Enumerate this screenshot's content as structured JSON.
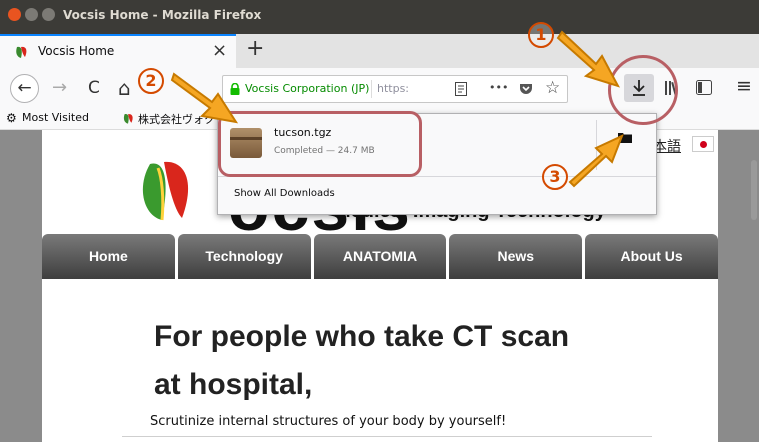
{
  "window": {
    "title": "Vocsis Home - Mozilla Firefox"
  },
  "tabs": [
    {
      "label": "Vocsis Home",
      "close": "×"
    }
  ],
  "toolbar": {
    "new_tab": "+",
    "back": "←",
    "forward": "→",
    "reload": "C",
    "home": "⌂",
    "identity": "Vocsis Corporation (JP)",
    "url_partial": "https:",
    "more": "•••",
    "star": "☆",
    "download": "↓",
    "menu": "≡"
  },
  "bookmarks": {
    "items": [
      "Most Visited",
      "株式会社ヴォク"
    ]
  },
  "download_panel": {
    "filename": "tucson.tgz",
    "status": "Completed — 24.7 MB",
    "show_all": "Show All Downloads"
  },
  "page": {
    "lang_link": "本語",
    "logo_text": "ocsis",
    "tagline": "Medical Imaging Technology",
    "nav": [
      "Home",
      "Technology",
      "ANATOMIA",
      "News",
      "About Us"
    ],
    "headline1": "For people who take CT scan",
    "headline2": "at hospital,",
    "subheading": "Scrutinize internal structures of your body by yourself!"
  },
  "annotations": {
    "step1": "1",
    "step2": "2",
    "step3": "3"
  },
  "colors": {
    "accent": "#0a84ff",
    "annotation": "#d44a00",
    "highlight": "#b85f64",
    "secure": "#058b00"
  }
}
